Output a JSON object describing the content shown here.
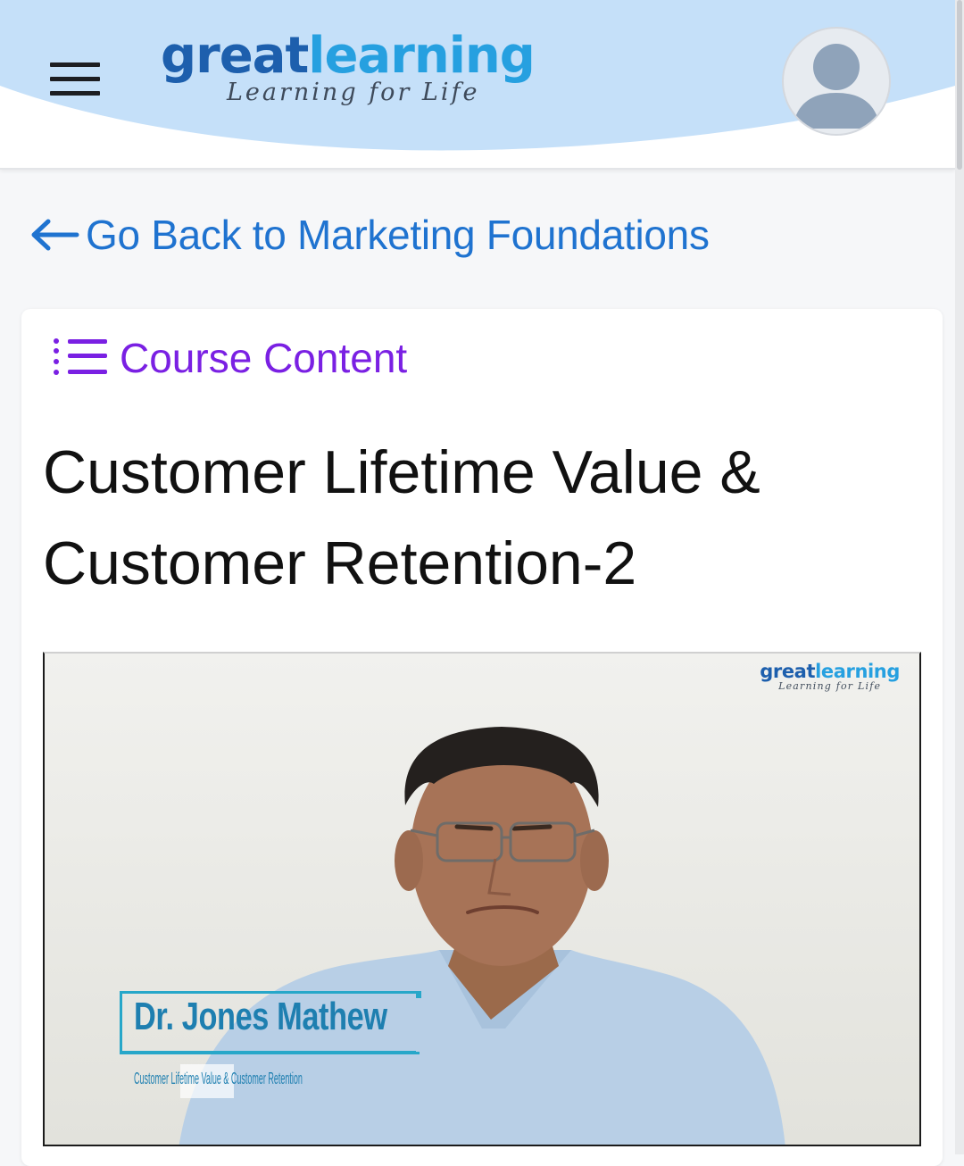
{
  "header": {
    "logo": {
      "word_part1": "great",
      "word_part2": "learning",
      "tagline": "Learning for Life"
    },
    "menu_icon": "hamburger-icon",
    "avatar_icon": "user-avatar-icon",
    "colors": {
      "wave": "#c5e0f9",
      "logo_dark": "#1d5fad",
      "logo_light": "#26a0e0"
    }
  },
  "back_link": {
    "label": "Go Back to Marketing Foundations",
    "icon": "arrow-left-icon",
    "color": "#1f73d0"
  },
  "course_content": {
    "label": "Course Content",
    "icon": "list-icon",
    "color": "#7a20e3"
  },
  "lesson": {
    "title": "Customer Lifetime Value & Customer Retention-2"
  },
  "video": {
    "watermark": {
      "word_part1": "great",
      "word_part2": "learning",
      "tagline": "Learning for Life"
    },
    "lower_third": {
      "name": "Dr. Jones Mathew",
      "subtitle": "Customer Lifetime Value & Customer Retention"
    }
  }
}
